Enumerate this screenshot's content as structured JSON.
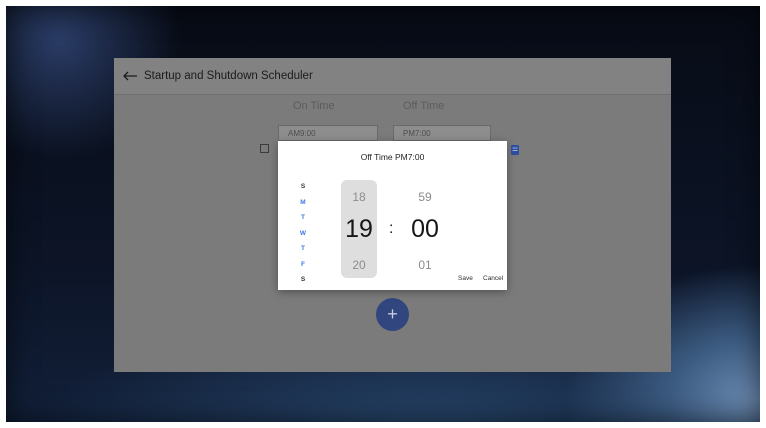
{
  "app": {
    "title": "Startup and Shutdown Scheduler",
    "columns": {
      "on_time": "On Time",
      "off_time": "Off Time"
    },
    "schedule_row": {
      "on_time_value": "AM9:00",
      "off_time_value": "PM7:00"
    },
    "add_button_label": "+"
  },
  "dialog": {
    "title": "Off Time PM7:00",
    "days": [
      {
        "label": "S",
        "color": "#333333"
      },
      {
        "label": "M",
        "color": "#3a78e0"
      },
      {
        "label": "T",
        "color": "#3a78e0"
      },
      {
        "label": "W",
        "color": "#3a78e0"
      },
      {
        "label": "T",
        "color": "#3a78e0"
      },
      {
        "label": "F",
        "color": "#3a78e0"
      },
      {
        "label": "S",
        "color": "#333333"
      }
    ],
    "hour": {
      "prev": "18",
      "current": "19",
      "next": "20"
    },
    "separator": ":",
    "minute": {
      "prev": "59",
      "current": "00",
      "next": "01"
    },
    "save_label": "Save",
    "cancel_label": "Cancel"
  },
  "colors": {
    "accent": "#31457f",
    "weekday": "#3a78e0",
    "delete_icon": "#2e4fa0"
  }
}
